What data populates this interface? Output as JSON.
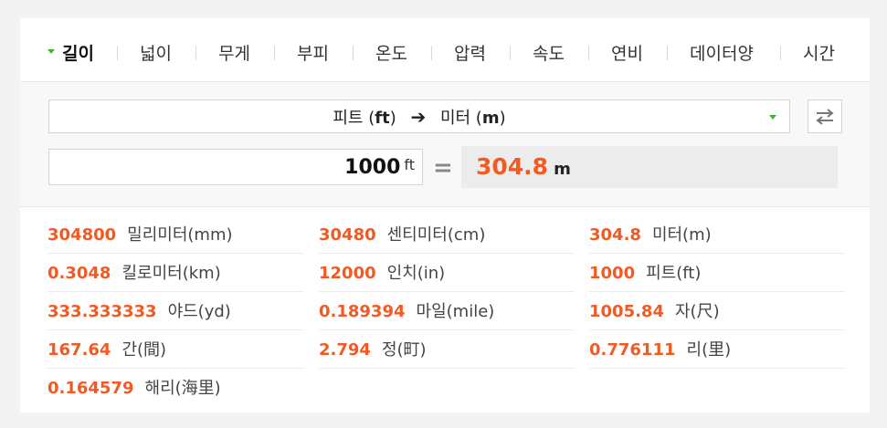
{
  "tabs": [
    {
      "label": "길이",
      "active": true
    },
    {
      "label": "넓이"
    },
    {
      "label": "무게"
    },
    {
      "label": "부피"
    },
    {
      "label": "온도"
    },
    {
      "label": "압력"
    },
    {
      "label": "속도"
    },
    {
      "label": "연비"
    },
    {
      "label": "데이터양"
    },
    {
      "label": "시간"
    }
  ],
  "converter": {
    "from_name": "피트",
    "from_unit": "ft",
    "to_name": "미터",
    "to_unit": "m",
    "arrow": "➔",
    "input_value": "1000",
    "input_unit": "ft",
    "equals": "=",
    "result_value": "304.8",
    "result_unit": "m"
  },
  "results": [
    {
      "value": "304800",
      "name": "밀리미터(mm)"
    },
    {
      "value": "30480",
      "name": "센티미터(cm)"
    },
    {
      "value": "304.8",
      "name": "미터(m)"
    },
    {
      "value": "0.3048",
      "name": "킬로미터(km)"
    },
    {
      "value": "12000",
      "name": "인치(in)"
    },
    {
      "value": "1000",
      "name": "피트(ft)"
    },
    {
      "value": "333.333333",
      "name": "야드(yd)"
    },
    {
      "value": "0.189394",
      "name": "마일(mile)"
    },
    {
      "value": "1005.84",
      "name": "자(尺)"
    },
    {
      "value": "167.64",
      "name": "간(間)"
    },
    {
      "value": "2.794",
      "name": "정(町)"
    },
    {
      "value": "0.776111",
      "name": "리(里)"
    },
    {
      "value": "0.164579",
      "name": "해리(海里)"
    }
  ],
  "colors": {
    "accent": "#f25a24",
    "caret": "#3cb433"
  }
}
